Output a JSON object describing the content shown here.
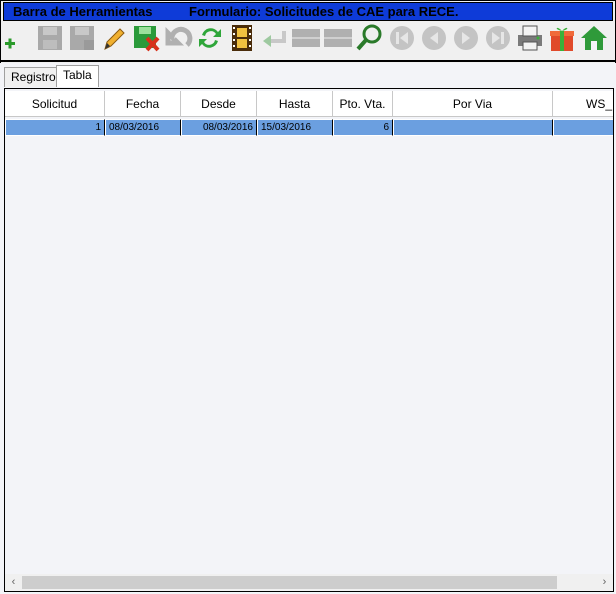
{
  "window": {
    "toolbar_title": "Barra de Herramientas",
    "form_title": "Formulario: Solicitudes de CAE para RECE."
  },
  "toolbar": {
    "buttons": [
      {
        "name": "add-icon"
      },
      {
        "name": "save-icon"
      },
      {
        "name": "save-as-icon"
      },
      {
        "name": "edit-pencil-icon"
      },
      {
        "name": "delete-icon"
      },
      {
        "name": "undo-icon"
      },
      {
        "name": "refresh-icon"
      },
      {
        "name": "film-icon"
      },
      {
        "name": "back-arrow-icon"
      },
      {
        "name": "blank-1-icon"
      },
      {
        "name": "blank-2-icon"
      },
      {
        "name": "search-icon"
      },
      {
        "name": "first-record-icon"
      },
      {
        "name": "prev-record-icon"
      },
      {
        "name": "next-record-icon"
      },
      {
        "name": "last-record-icon"
      },
      {
        "name": "printer-icon"
      },
      {
        "name": "gift-icon"
      },
      {
        "name": "home-icon"
      }
    ]
  },
  "tabs": [
    {
      "label": "Registro"
    },
    {
      "label": "Tabla"
    }
  ],
  "table": {
    "columns": [
      "Solicitud",
      "Fecha",
      "Desde",
      "Hasta",
      "Pto. Vta.",
      "Por Via",
      "WS_I"
    ],
    "rows": [
      [
        "1",
        "08/03/2016",
        "08/03/2016",
        "15/03/2016",
        "6",
        "",
        ""
      ]
    ]
  },
  "scrollbar": {
    "left_arrow": "‹",
    "right_arrow": "›"
  }
}
